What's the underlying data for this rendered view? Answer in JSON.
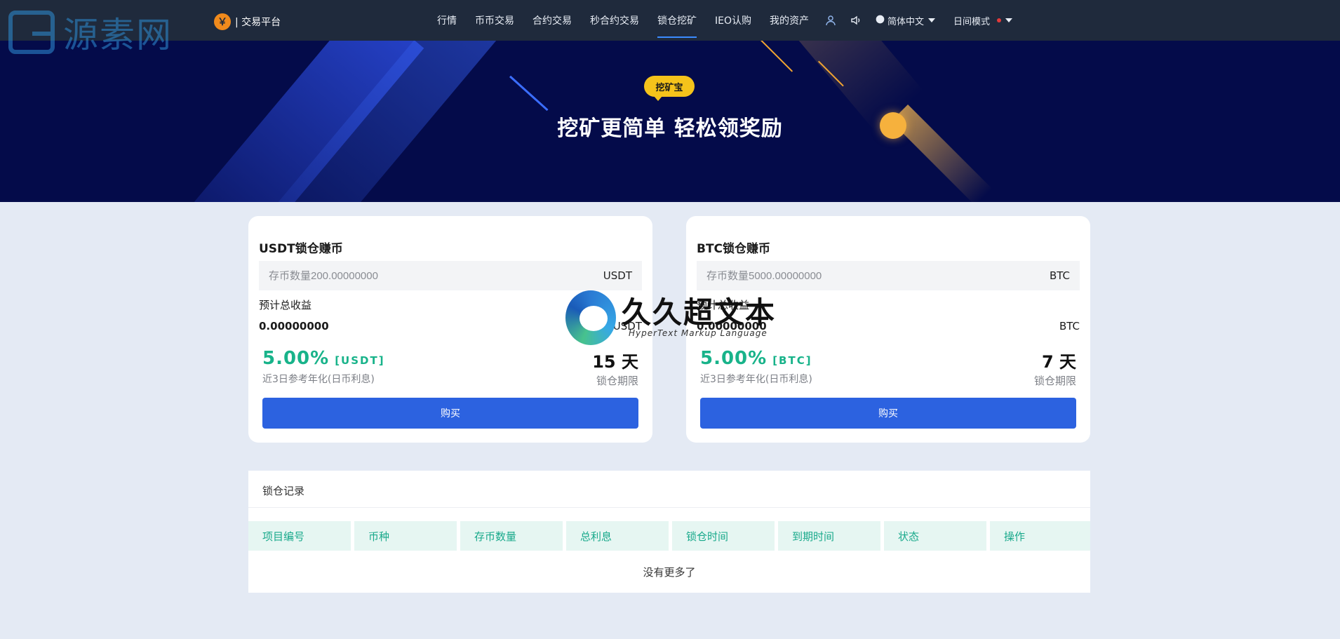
{
  "watermark_logo": {
    "text": "源素网"
  },
  "header": {
    "brand_icon": "￥",
    "brand_label": "| 交易平台",
    "nav": [
      "行情",
      "币币交易",
      "合约交易",
      "秒合约交易",
      "锁仓挖矿",
      "IEO认购",
      "我的资产"
    ],
    "active_nav": "锁仓挖矿",
    "icons": [
      "user-icon",
      "speaker-icon",
      "globe-icon"
    ],
    "language": "简体中文",
    "theme_mode": "日间模式"
  },
  "hero": {
    "badge": "挖矿宝",
    "title": "挖矿更简单 轻松领奖励"
  },
  "cards": [
    {
      "title": "USDT锁仓赚币",
      "placeholder": "存币数量200.00000000",
      "unit": "USDT",
      "est_label": "预计总收益",
      "est_value": "0.00000000",
      "est_unit": "USDT",
      "rate": "5.00%",
      "rate_tag": "[USDT]",
      "rate_desc": "近3日参考年化(日币利息)",
      "days": "15 天",
      "days_label": "锁仓期限",
      "buy": "购买"
    },
    {
      "title": "BTC锁仓赚币",
      "placeholder": "存币数量5000.00000000",
      "unit": "BTC",
      "est_label": "预计总收益",
      "est_value": "0.00000000",
      "est_unit": "BTC",
      "rate": "5.00%",
      "rate_tag": "[BTC]",
      "rate_desc": "近3日参考年化(日币利息)",
      "days": "7 天",
      "days_label": "锁仓期限",
      "buy": "购买"
    }
  ],
  "records": {
    "title": "锁仓记录",
    "columns": [
      "项目编号",
      "币种",
      "存币数量",
      "总利息",
      "锁仓时间",
      "到期时间",
      "状态",
      "操作"
    ],
    "empty": "没有更多了"
  },
  "watermark": {
    "main": "久久超文本",
    "sub": "HyperText Markup Language"
  },
  "colors": {
    "nav_bg": "#1f2a3c",
    "hero_bg": "#040b4a",
    "accent_green": "#18b38a",
    "button_blue": "#2c62e0",
    "badge_yellow": "#f5c31b"
  }
}
